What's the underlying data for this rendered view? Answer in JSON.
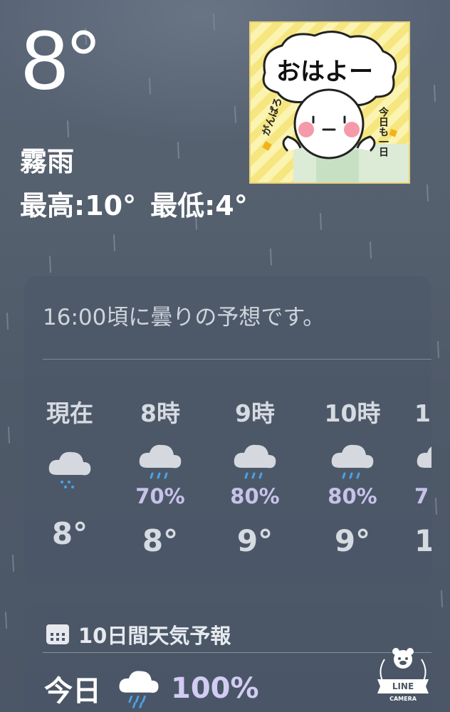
{
  "current": {
    "temperature": "8°",
    "condition": "霧雨",
    "high": "最高:10°",
    "low": "最低:4°"
  },
  "sticker": {
    "greeting": "おはよー",
    "side_text": "今日も一日",
    "left_text": "がんばろ"
  },
  "hourly": {
    "summary": "16:00頃に曇りの予想です。",
    "items": [
      {
        "label": "現在",
        "icon": "cloud-drizzle-icon",
        "pop": "",
        "temp": "8°"
      },
      {
        "label": "8時",
        "icon": "cloud-rain-icon",
        "pop": "70%",
        "temp": "8°"
      },
      {
        "label": "9時",
        "icon": "cloud-rain-icon",
        "pop": "80%",
        "temp": "9°"
      },
      {
        "label": "10時",
        "icon": "cloud-rain-icon",
        "pop": "80%",
        "temp": "9°"
      },
      {
        "label": "1",
        "icon": "cloud-rain-icon",
        "pop": "7",
        "temp": "1"
      }
    ]
  },
  "forecast": {
    "title": "10日間天気予報",
    "header_icon": "calendar-icon",
    "rows": [
      {
        "day": "今日",
        "icon": "cloud-rain-icon",
        "pop": "100%"
      }
    ]
  },
  "watermark": {
    "brand_line1": "LINE",
    "brand_line2": "CAMERA"
  },
  "colors": {
    "background": "#525d6d",
    "card": "#4b5768",
    "pop_text": "#c7c2ea",
    "drop_blue": "#4aa3e8"
  }
}
